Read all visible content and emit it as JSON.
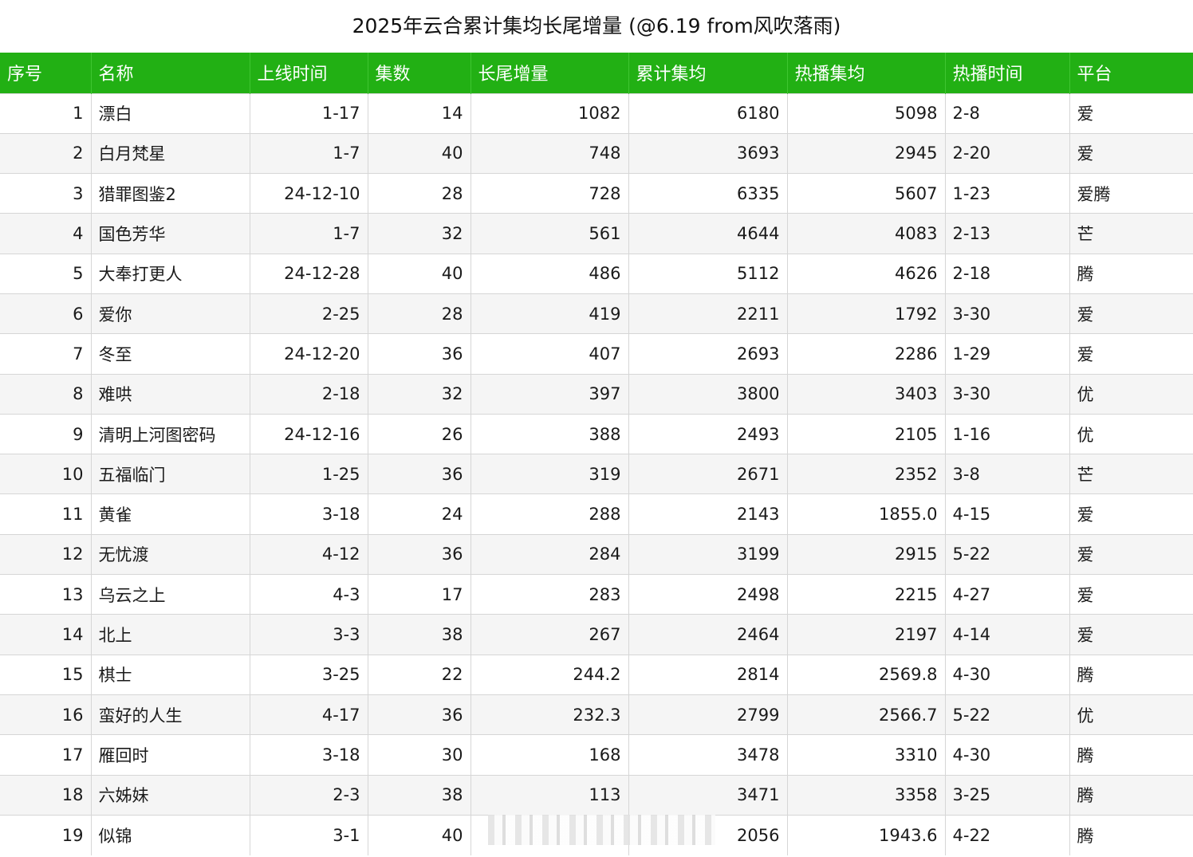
{
  "title": "2025年云合累计集均长尾增量 (@6.19 from风吹落雨)",
  "table": {
    "headers": [
      "序号",
      "名称",
      "上线时间",
      "集数",
      "长尾增量",
      "累计集均",
      "热播集均",
      "热播时间",
      "平台"
    ],
    "rows": [
      [
        "1",
        "漂白",
        "1-17",
        "14",
        "1082",
        "6180",
        "5098",
        "2-8",
        "爱"
      ],
      [
        "2",
        "白月梵星",
        "1-7",
        "40",
        "748",
        "3693",
        "2945",
        "2-20",
        "爱"
      ],
      [
        "3",
        "猎罪图鉴2",
        "24-12-10",
        "28",
        "728",
        "6335",
        "5607",
        "1-23",
        "爱腾"
      ],
      [
        "4",
        "国色芳华",
        "1-7",
        "32",
        "561",
        "4644",
        "4083",
        "2-13",
        "芒"
      ],
      [
        "5",
        "大奉打更人",
        "24-12-28",
        "40",
        "486",
        "5112",
        "4626",
        "2-18",
        "腾"
      ],
      [
        "6",
        "爱你",
        "2-25",
        "28",
        "419",
        "2211",
        "1792",
        "3-30",
        "爱"
      ],
      [
        "7",
        "冬至",
        "24-12-20",
        "36",
        "407",
        "2693",
        "2286",
        "1-29",
        "爱"
      ],
      [
        "8",
        "难哄",
        "2-18",
        "32",
        "397",
        "3800",
        "3403",
        "3-30",
        "优"
      ],
      [
        "9",
        "清明上河图密码",
        "24-12-16",
        "26",
        "388",
        "2493",
        "2105",
        "1-16",
        "优"
      ],
      [
        "10",
        "五福临门",
        "1-25",
        "36",
        "319",
        "2671",
        "2352",
        "3-8",
        "芒"
      ],
      [
        "11",
        "黄雀",
        "3-18",
        "24",
        "288",
        "2143",
        "1855.0",
        "4-15",
        "爱"
      ],
      [
        "12",
        "无忧渡",
        "4-12",
        "36",
        "284",
        "3199",
        "2915",
        "5-22",
        "爱"
      ],
      [
        "13",
        "乌云之上",
        "4-3",
        "17",
        "283",
        "2498",
        "2215",
        "4-27",
        "爱"
      ],
      [
        "14",
        "北上",
        "3-3",
        "38",
        "267",
        "2464",
        "2197",
        "4-14",
        "爱"
      ],
      [
        "15",
        "棋士",
        "3-25",
        "22",
        "244.2",
        "2814",
        "2569.8",
        "4-30",
        "腾"
      ],
      [
        "16",
        "蛮好的人生",
        "4-17",
        "36",
        "232.3",
        "2799",
        "2566.7",
        "5-22",
        "优"
      ],
      [
        "17",
        "雁回时",
        "3-18",
        "30",
        "168",
        "3478",
        "3310",
        "4-30",
        "腾"
      ],
      [
        "18",
        "六姊妹",
        "2-3",
        "38",
        "113",
        "3471",
        "3358",
        "3-25",
        "腾"
      ],
      [
        "19",
        "似锦",
        "3-1",
        "40",
        "",
        "2056",
        "1943.6",
        "4-22",
        "腾"
      ]
    ]
  },
  "colors": {
    "header_bg": "#22b014",
    "header_text": "#ffffff",
    "row_alt_bg": "#f5f5f5"
  }
}
